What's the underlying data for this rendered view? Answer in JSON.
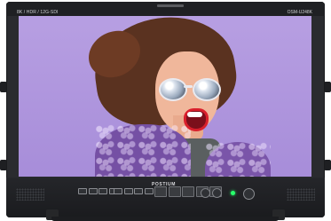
{
  "header": {
    "spec_text": "8K / HDR / 12G-SDI",
    "model_text": "OSM-U248K"
  },
  "footer": {
    "brand_text": "POSTIUM"
  },
  "screen": {
    "subject": "woman-with-sunglasses-and-purple-fur-jacket"
  },
  "colors": {
    "bezel": "#2a2b2f",
    "screen_bg": "#a990d8",
    "fur": "#7550a4",
    "hair": "#5a3220",
    "led_green": "#28ff6c"
  },
  "controls": {
    "left_group_count": 4,
    "middle_group_count": 5,
    "right_group_count": 5
  }
}
